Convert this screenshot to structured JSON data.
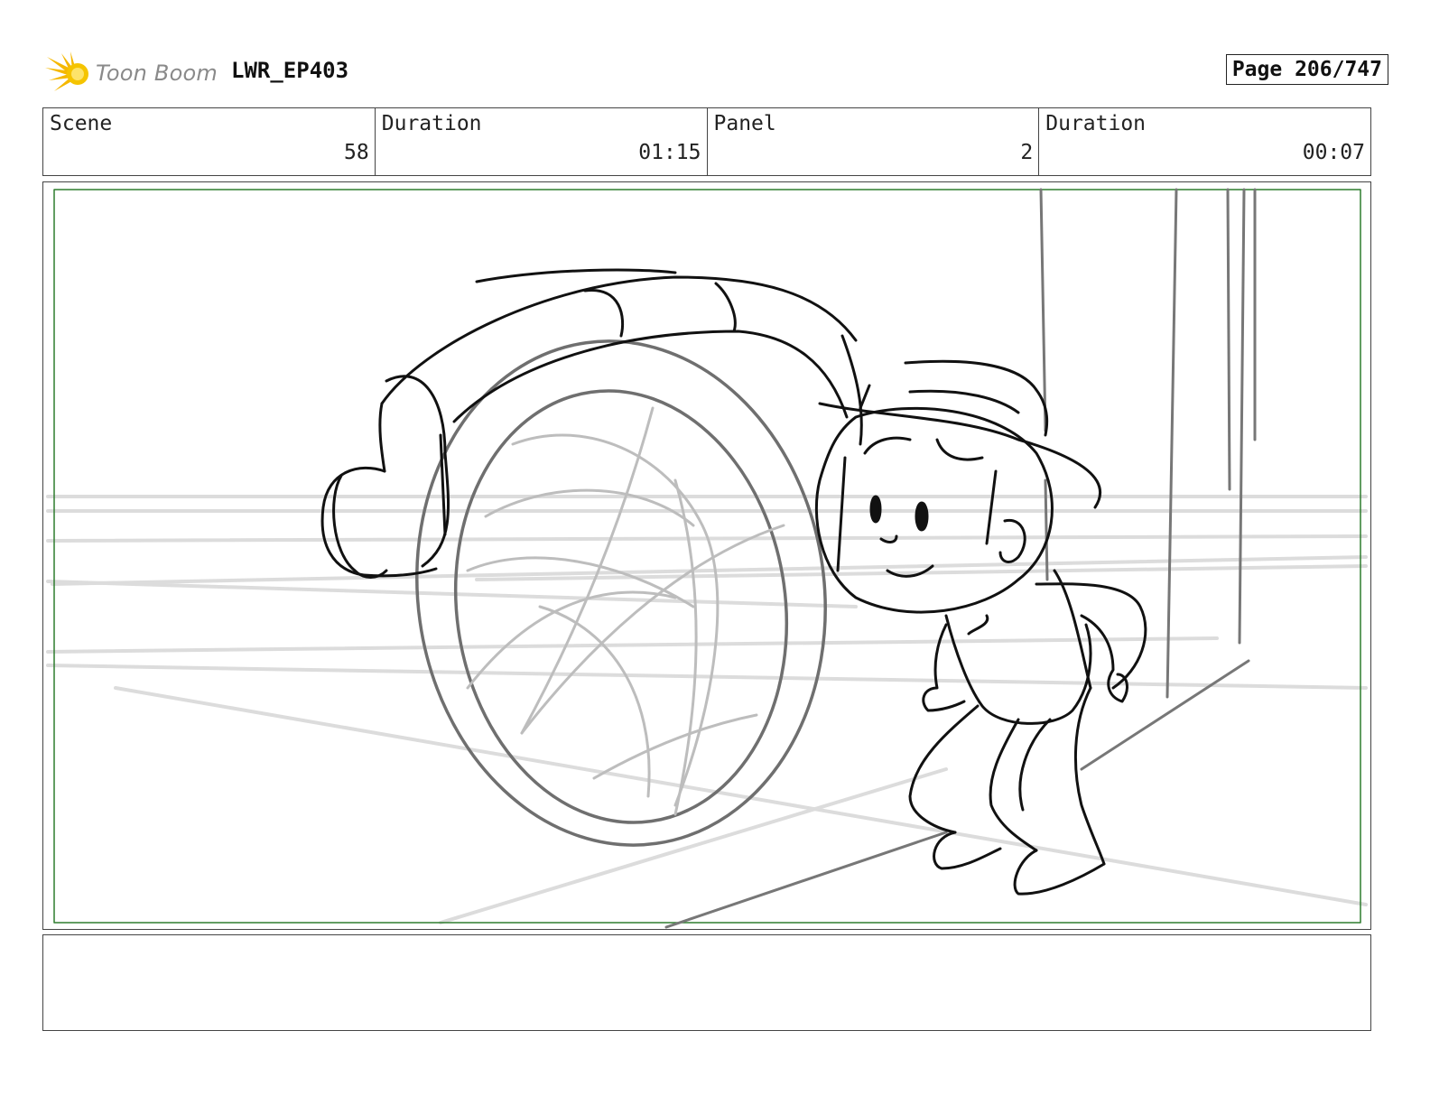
{
  "header": {
    "logo_text": "Toon Boom",
    "project": "LWR_EP403",
    "page_label": "Page 206/747"
  },
  "info": {
    "scene_label": "Scene",
    "scene_value": "58",
    "scene_duration_label": "Duration",
    "scene_duration_value": "01:15",
    "panel_label": "Panel",
    "panel_value": "2",
    "panel_duration_label": "Duration",
    "panel_duration_value": "00:07"
  },
  "notes": {
    "text": ""
  },
  "colors": {
    "safe_frame": "#2e7d2e",
    "logo_burst": "#f5b800",
    "logo_text": "#8a8a8a"
  },
  "icons": {
    "logo": "starburst-icon"
  }
}
